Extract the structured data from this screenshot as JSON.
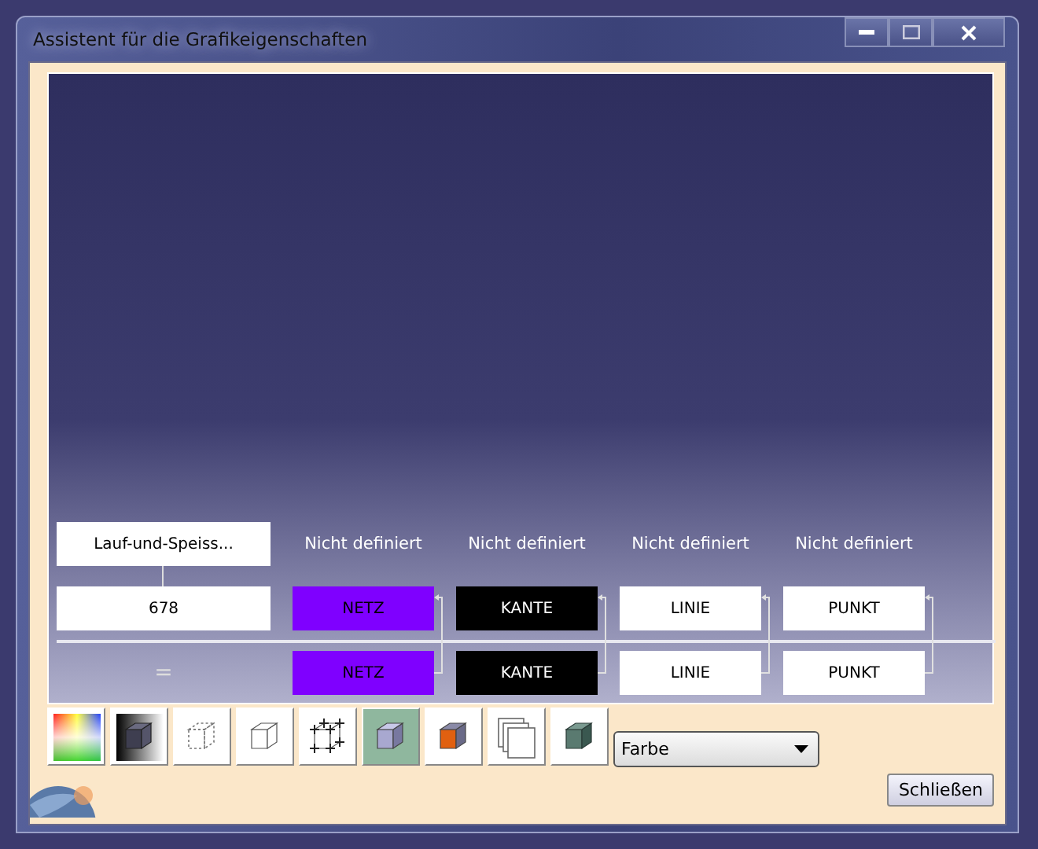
{
  "window": {
    "title": "Assistent für die Grafikeigenschaften"
  },
  "hierarchy": {
    "name": "Lauf-und-Speiss...",
    "id": "678",
    "operator": "="
  },
  "columns": [
    {
      "header": "Nicht definiert",
      "top": {
        "label": "NETZ",
        "color": "#7f00ff"
      },
      "bottom": {
        "label": "NETZ",
        "color": "#7f00ff"
      }
    },
    {
      "header": "Nicht definiert",
      "top": {
        "label": "KANTE",
        "color": "#000000"
      },
      "bottom": {
        "label": "KANTE",
        "color": "#000000"
      }
    },
    {
      "header": "Nicht definiert",
      "top": {
        "label": "LINIE",
        "color": "#ffffff"
      },
      "bottom": {
        "label": "LINIE",
        "color": "#ffffff"
      }
    },
    {
      "header": "Nicht definiert",
      "top": {
        "label": "PUNKT",
        "color": "#ffffff"
      },
      "bottom": {
        "label": "PUNKT",
        "color": "#ffffff"
      }
    }
  ],
  "toolbar": [
    {
      "kind": "spectrum",
      "selected": false
    },
    {
      "kind": "shade",
      "selected": false
    },
    {
      "kind": "dashed-cube",
      "selected": false
    },
    {
      "kind": "wire-cube",
      "selected": false
    },
    {
      "kind": "points-cube",
      "selected": false
    },
    {
      "kind": "shaded-cube",
      "selected": true
    },
    {
      "kind": "orange-cube",
      "selected": false
    },
    {
      "kind": "layers",
      "selected": false
    },
    {
      "kind": "dark-cube",
      "selected": false
    }
  ],
  "dropdown": {
    "value": "Farbe"
  },
  "close_button": {
    "label": "Schließen"
  }
}
